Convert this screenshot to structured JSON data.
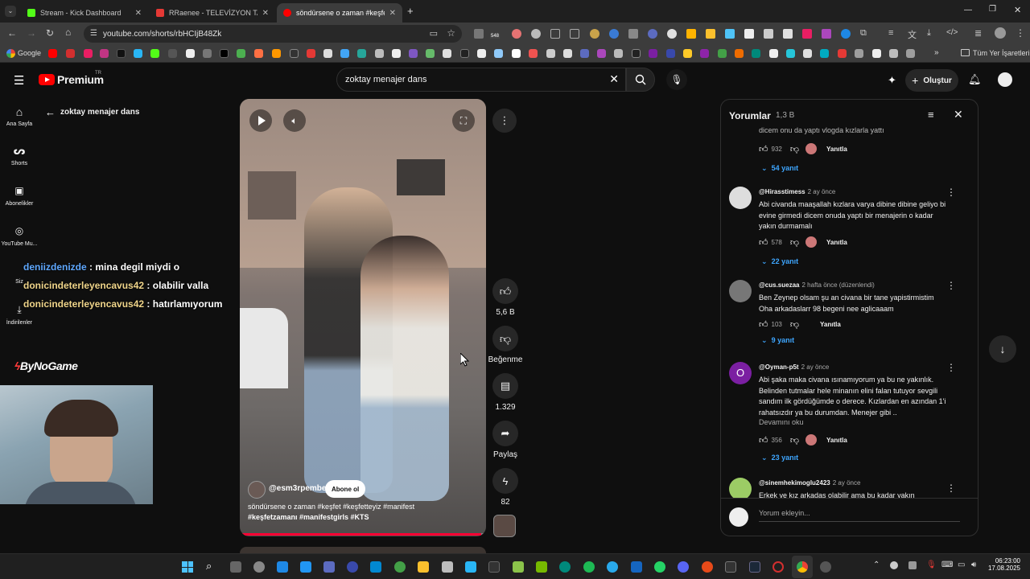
{
  "browser": {
    "tabs": [
      {
        "title": "Stream - Kick Dashboard",
        "active": false,
        "color": "#53fc18"
      },
      {
        "title": "RRaenee - TELEVİZYON TARİHİN",
        "active": false,
        "color": "#e53935"
      },
      {
        "title": "söndürsene o zaman #keşfet #k",
        "active": true,
        "color": "#ff0000"
      }
    ],
    "new_tab": "+",
    "url": "youtube.com/shorts/rbHCIjB48Zk",
    "bookmarks_first": "Google",
    "bookmarks_all": "Tüm Yer İşaretleri",
    "ext_badge": "548"
  },
  "youtube": {
    "logo_text": "Premium",
    "logo_badge": "TR",
    "search_value": "zoktay menajer dans",
    "create_label": "Oluştur",
    "back_title": "zoktay menajer dans",
    "nav": [
      {
        "label": "Ana Sayfa"
      },
      {
        "label": "Shorts"
      },
      {
        "label": "Abonelikler"
      },
      {
        "label": "YouTube Mu..."
      },
      {
        "label": "Siz"
      },
      {
        "label": "İndirilenler"
      }
    ]
  },
  "overlay": {
    "chat": [
      {
        "user": "deniizdenizde",
        "msg": ": mina degil miydi o"
      },
      {
        "user": "donicindeterleyencavus42",
        "msg": ": olabilir valla"
      },
      {
        "user": "donicindeterleyencavus42",
        "msg": ": hatırlamıyorum"
      }
    ],
    "brand": "ByNoGame"
  },
  "short": {
    "channel": "@esm3rpembe",
    "subscribe": "Abone ol",
    "caption_line1": "söndürsene o zaman #keşfet #keşfetteyiz #manifest",
    "caption_line2": "#keşfetzamanı #manifestgirls #KTS",
    "progress": 0.98,
    "likes": "5,6 B",
    "dislike_label": "Beğenme",
    "comments_count": "1.329",
    "share_label": "Paylaş",
    "remix_count": "82"
  },
  "comments": {
    "title": "Yorumlar",
    "count": "1,3 B",
    "partial_top": "dicem onu da yaptı vlogda kızlarla yattı",
    "top_likes": "932",
    "top_replies": "54 yanıt",
    "reply_label": "Yanıtla",
    "items": [
      {
        "author": "@Hirasstimess",
        "time": "2 ay önce",
        "text": "Abi civanda maaşallah kızlara varya dibine dibine geliyo bi evine girmedi dicem onuda yaptı bir menajerin o kadar yakın durmamalı",
        "likes": "578",
        "replies": "22 yanıt"
      },
      {
        "author": "@cus.suezaa",
        "time": "2 hafta önce (düzenlendi)",
        "text": "Ben Zeynep olsam şu an civana bir tane yapistirmistim Oha arkadaslarr 98 begeni nee aglicaaam",
        "likes": "103",
        "replies": "9 yanıt"
      },
      {
        "author": "@Oyman-p5t",
        "time": "2 ay önce",
        "text": "Abi şaka maka civana ısınamıyorum ya bu ne yakınlık. Belinden tutmalar hele minanın elini falan tutuyor sevgili sandım ilk gördüğümde o derece. Kızlardan en azından 1'i rahatsızdır ya bu durumdan. Menejer gibi ..",
        "more": "Devamını oku",
        "likes": "356",
        "replies": "23 yanıt",
        "avatar_letter": "O"
      },
      {
        "author": "@sinemhekimoglu2423",
        "time": "2 ay önce",
        "text": "Erkek ve kız arkadaş olabilir ama bu kadar yakın"
      }
    ],
    "add_placeholder": "Yorum ekleyin..."
  },
  "taskbar": {
    "time": "06:23:00",
    "date": "17.08.2025"
  },
  "colors": {
    "yt_red": "#ff0000",
    "link_blue": "#3ea6ff",
    "accent_purple": "#7b1fa2"
  }
}
